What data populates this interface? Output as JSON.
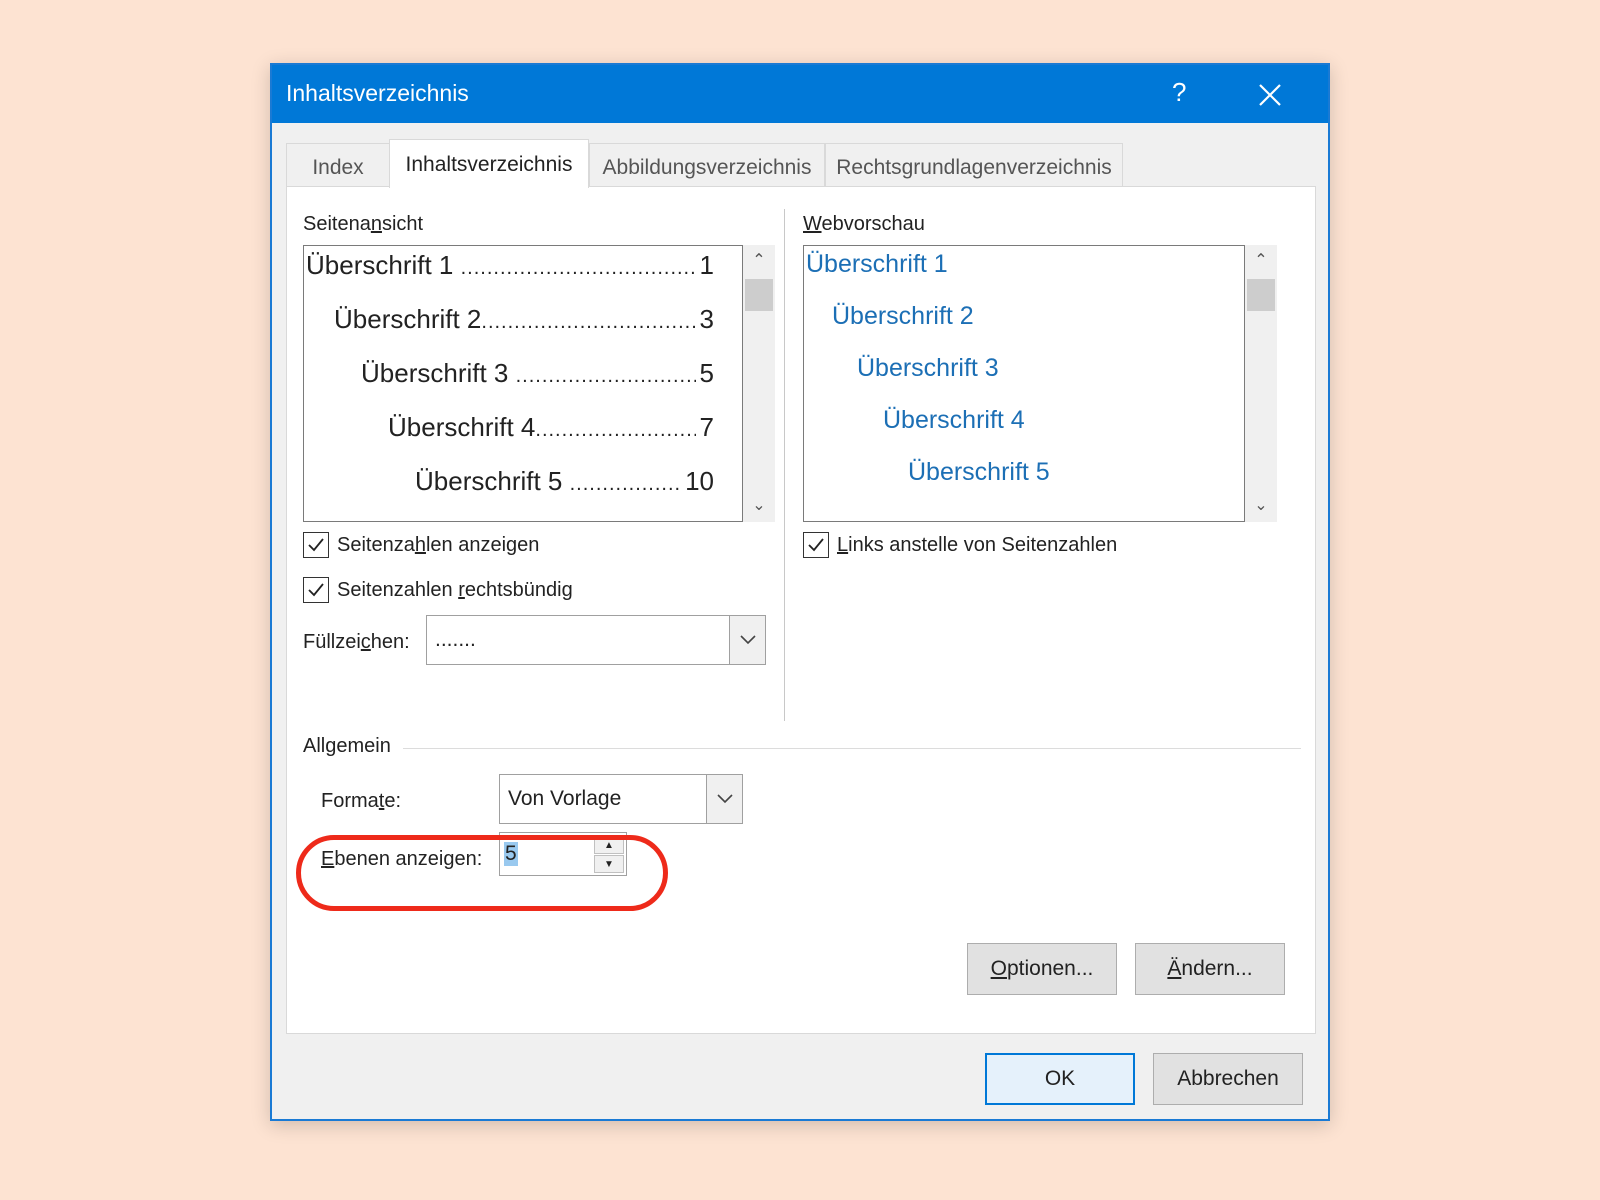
{
  "dialog": {
    "title": "Inhaltsverzeichnis",
    "help_label": "?",
    "tabs": [
      {
        "label": "Index"
      },
      {
        "label": "Inhaltsverzeichnis",
        "active": true
      },
      {
        "label": "Abbildungsverzeichnis"
      },
      {
        "label": "Rechtsgrundlagenverzeichnis"
      }
    ]
  },
  "seitenansicht": {
    "heading_pre": "Seitena",
    "heading_u": "n",
    "heading_post": "sicht",
    "entries": [
      {
        "text": "Überschrift 1",
        "page": "1"
      },
      {
        "text": "Überschrift 2",
        "page": "3"
      },
      {
        "text": "Überschrift 3",
        "page": "5"
      },
      {
        "text": "Überschrift 4",
        "page": "7"
      },
      {
        "text": "Überschrift 5",
        "page": "10"
      }
    ],
    "dots": "............................................................",
    "show_page_numbers": {
      "pre": "Seitenza",
      "u": "h",
      "post": "len anzeigen",
      "checked": true
    },
    "right_align": {
      "pre": "Seitenzahlen ",
      "u": "r",
      "post": "echtsbündig",
      "checked": true
    },
    "leader": {
      "label_pre": "Füllzei",
      "label_u": "c",
      "label_post": "hen:",
      "value": "......."
    }
  },
  "webvorschau": {
    "heading_u": "W",
    "heading_post": "ebvorschau",
    "entries": [
      "Überschrift 1",
      "Überschrift 2",
      "Überschrift 3",
      "Überschrift 4",
      "Überschrift 5"
    ],
    "links": {
      "pre": "",
      "u": "L",
      "post": "inks anstelle von Seitenzahlen",
      "checked": true
    }
  },
  "allgemein": {
    "heading": "Allgemein",
    "formats": {
      "label_pre": "Forma",
      "label_u": "t",
      "label_post": "e:",
      "value": "Von Vorlage"
    },
    "levels": {
      "label_u": "E",
      "label_post": "benen anzeigen:",
      "value": "5"
    }
  },
  "buttons": {
    "options": {
      "u": "O",
      "post": "ptionen..."
    },
    "modify": {
      "u": "Ä",
      "post": "ndern..."
    },
    "ok": "OK",
    "cancel": "Abbrechen"
  },
  "colors": {
    "titlebar": "#0078d7",
    "web_link": "#1c6fb5",
    "highlight": "#ee2a1a",
    "background": "#fde3d2"
  }
}
